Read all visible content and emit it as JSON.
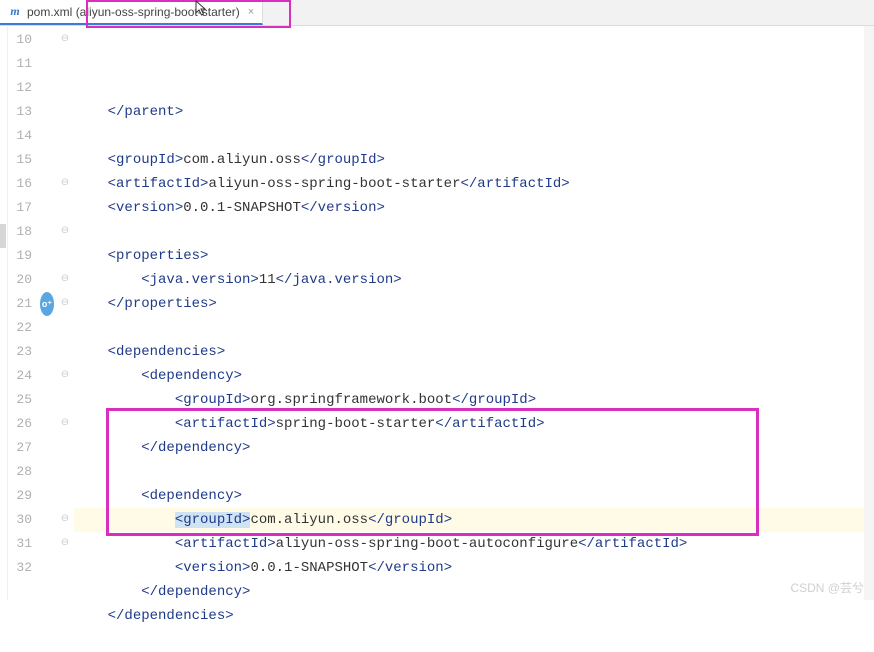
{
  "tab": {
    "icon_letter": "m",
    "filename": "pom.xml",
    "suffix": "(aliyun-oss-spring-boot-starter)",
    "close": "×"
  },
  "lines": {
    "start": 10,
    "end": 32
  },
  "code": [
    {
      "n": 10,
      "type": "plain",
      "indent": 1,
      "segs": [
        {
          "t": "tag",
          "v": "</parent>"
        }
      ]
    },
    {
      "n": 11,
      "type": "blank"
    },
    {
      "n": 12,
      "type": "plain",
      "indent": 1,
      "segs": [
        {
          "t": "tag",
          "v": "<groupId>"
        },
        {
          "t": "text",
          "v": "com.aliyun.oss"
        },
        {
          "t": "tag",
          "v": "</groupId>"
        }
      ]
    },
    {
      "n": 13,
      "type": "plain",
      "indent": 1,
      "segs": [
        {
          "t": "tag",
          "v": "<artifactId>"
        },
        {
          "t": "text",
          "v": "aliyun-oss-spring-boot-starter"
        },
        {
          "t": "tag",
          "v": "</artifactId>"
        }
      ]
    },
    {
      "n": 14,
      "type": "plain",
      "indent": 1,
      "segs": [
        {
          "t": "tag",
          "v": "<version>"
        },
        {
          "t": "text",
          "v": "0.0.1-SNAPSHOT"
        },
        {
          "t": "tag",
          "v": "</version>"
        }
      ]
    },
    {
      "n": 15,
      "type": "blank"
    },
    {
      "n": 16,
      "type": "plain",
      "indent": 1,
      "segs": [
        {
          "t": "tag",
          "v": "<properties>"
        }
      ]
    },
    {
      "n": 17,
      "type": "plain",
      "indent": 2,
      "segs": [
        {
          "t": "tag",
          "v": "<java.version>"
        },
        {
          "t": "text",
          "v": "11"
        },
        {
          "t": "tag",
          "v": "</java.version>"
        }
      ]
    },
    {
      "n": 18,
      "type": "plain",
      "indent": 1,
      "segs": [
        {
          "t": "tag",
          "v": "</properties>"
        }
      ]
    },
    {
      "n": 19,
      "type": "blank"
    },
    {
      "n": 20,
      "type": "plain",
      "indent": 1,
      "segs": [
        {
          "t": "tag",
          "v": "<dependencies>"
        }
      ]
    },
    {
      "n": 21,
      "type": "plain",
      "indent": 2,
      "badge": "o⁺",
      "segs": [
        {
          "t": "tag",
          "v": "<dependency>"
        }
      ]
    },
    {
      "n": 22,
      "type": "plain",
      "indent": 3,
      "segs": [
        {
          "t": "tag",
          "v": "<groupId>"
        },
        {
          "t": "text",
          "v": "org.springframework.boot"
        },
        {
          "t": "tag",
          "v": "</groupId>"
        }
      ]
    },
    {
      "n": 23,
      "type": "plain",
      "indent": 3,
      "segs": [
        {
          "t": "tag",
          "v": "<artifactId>"
        },
        {
          "t": "text",
          "v": "spring-boot-starter"
        },
        {
          "t": "tag",
          "v": "</artifactId>"
        }
      ]
    },
    {
      "n": 24,
      "type": "plain",
      "indent": 2,
      "segs": [
        {
          "t": "tag",
          "v": "</dependency>"
        }
      ]
    },
    {
      "n": 25,
      "type": "blank"
    },
    {
      "n": 26,
      "type": "plain",
      "indent": 2,
      "segs": [
        {
          "t": "tag",
          "v": "<dependency>"
        }
      ]
    },
    {
      "n": 27,
      "type": "current",
      "indent": 3,
      "segs": [
        {
          "t": "tag",
          "sel": true,
          "v": "<groupId>"
        },
        {
          "t": "text",
          "v": "com.aliyun.oss"
        },
        {
          "t": "tag",
          "v": "</groupId>"
        }
      ]
    },
    {
      "n": 28,
      "type": "plain",
      "indent": 3,
      "segs": [
        {
          "t": "tag",
          "v": "<artifactId>"
        },
        {
          "t": "text",
          "v": "aliyun-oss-spring-boot-autoconfigure"
        },
        {
          "t": "tag",
          "v": "</artifactId>"
        }
      ]
    },
    {
      "n": 29,
      "type": "plain",
      "indent": 3,
      "segs": [
        {
          "t": "tag",
          "v": "<version>"
        },
        {
          "t": "text",
          "v": "0.0.1-SNAPSHOT"
        },
        {
          "t": "tag",
          "v": "</version>"
        }
      ]
    },
    {
      "n": 30,
      "type": "plain",
      "indent": 2,
      "segs": [
        {
          "t": "tag",
          "v": "</dependency>"
        }
      ]
    },
    {
      "n": 31,
      "type": "plain",
      "indent": 1,
      "segs": [
        {
          "t": "tag",
          "v": "</dependencies>"
        }
      ]
    },
    {
      "n": 32,
      "type": "blank"
    }
  ],
  "fold_marks": {
    "10": "⊖",
    "16": "⊖",
    "18": "⊖",
    "20": "⊖",
    "21": "⊖",
    "24": "⊖",
    "26": "⊖",
    "30": "⊖",
    "31": "⊖"
  },
  "highlight_box": {
    "top_line": 26,
    "bottom_line": 30
  },
  "watermark": "CSDN @芸兮"
}
